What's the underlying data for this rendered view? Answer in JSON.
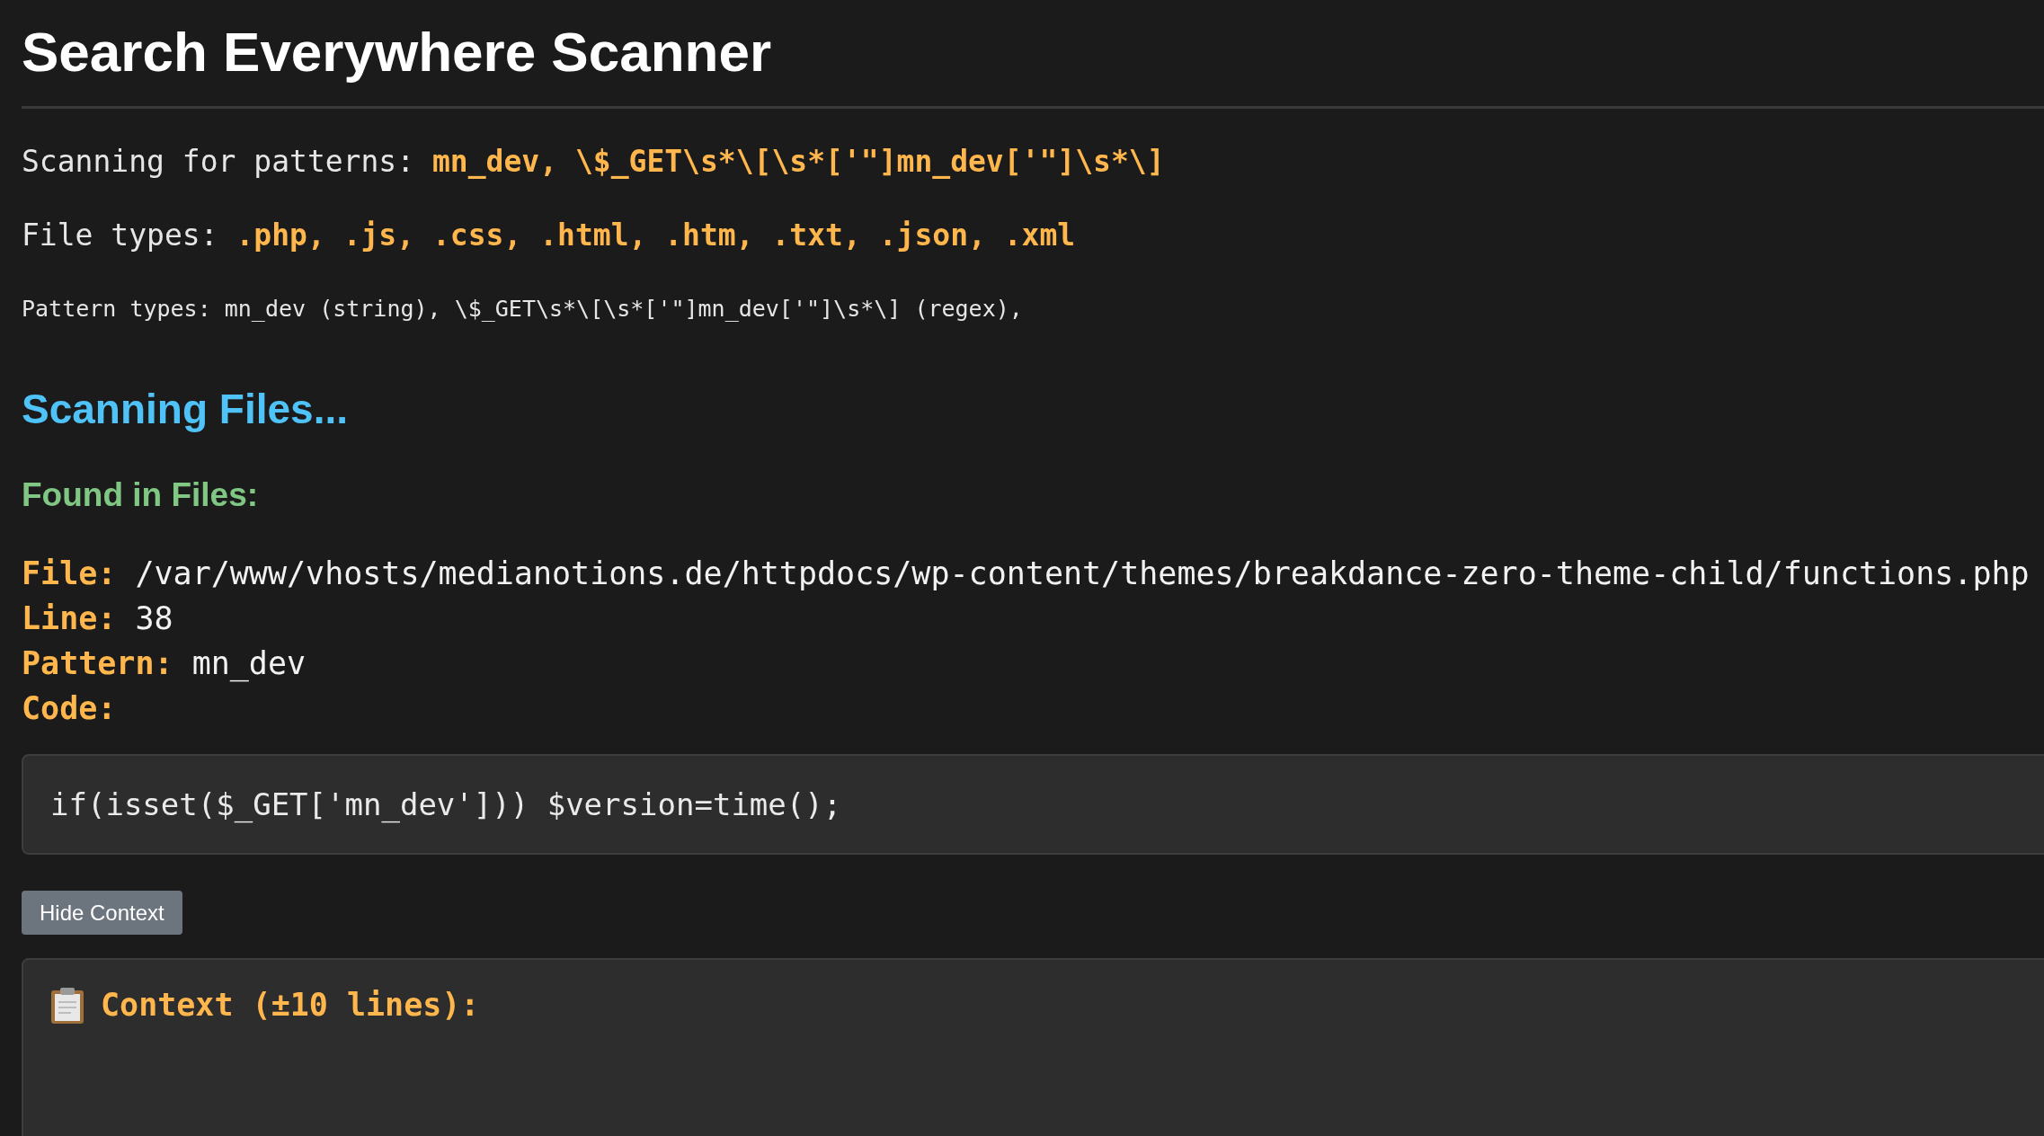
{
  "title": "Search Everywhere Scanner",
  "scan_info": [
    {
      "kind": "highlight",
      "label": "Scanning for patterns:",
      "value": "mn_dev, \\$_GET\\s*\\[\\s*['\"]mn_dev['\"]\\s*\\]"
    },
    {
      "kind": "highlight",
      "label": "File types:",
      "value": ".php, .js, .css, .html, .htm, .txt, .json, .xml"
    },
    {
      "kind": "small",
      "text": "Pattern types: mn_dev (string), \\$_GET\\s*\\[\\s*['\"]mn_dev['\"]\\s*\\] (regex),"
    }
  ],
  "progress_heading": "Scanning Files...",
  "results_heading": "Found in Files:",
  "result": {
    "fields": [
      {
        "label": "File:",
        "value": "/var/www/vhosts/medianotions.de/httpdocs/wp-content/themes/breakdance-zero-theme-child/functions.php"
      },
      {
        "label": "Line:",
        "value": "38"
      },
      {
        "label": "Pattern:",
        "value": "mn_dev"
      },
      {
        "label": "Code:"
      }
    ],
    "code": "if(isset($_GET['mn_dev'])) $version=time();",
    "toggle_button": "Hide Context",
    "context_expanded": true,
    "context_title": "Context (±10 lines):"
  }
}
